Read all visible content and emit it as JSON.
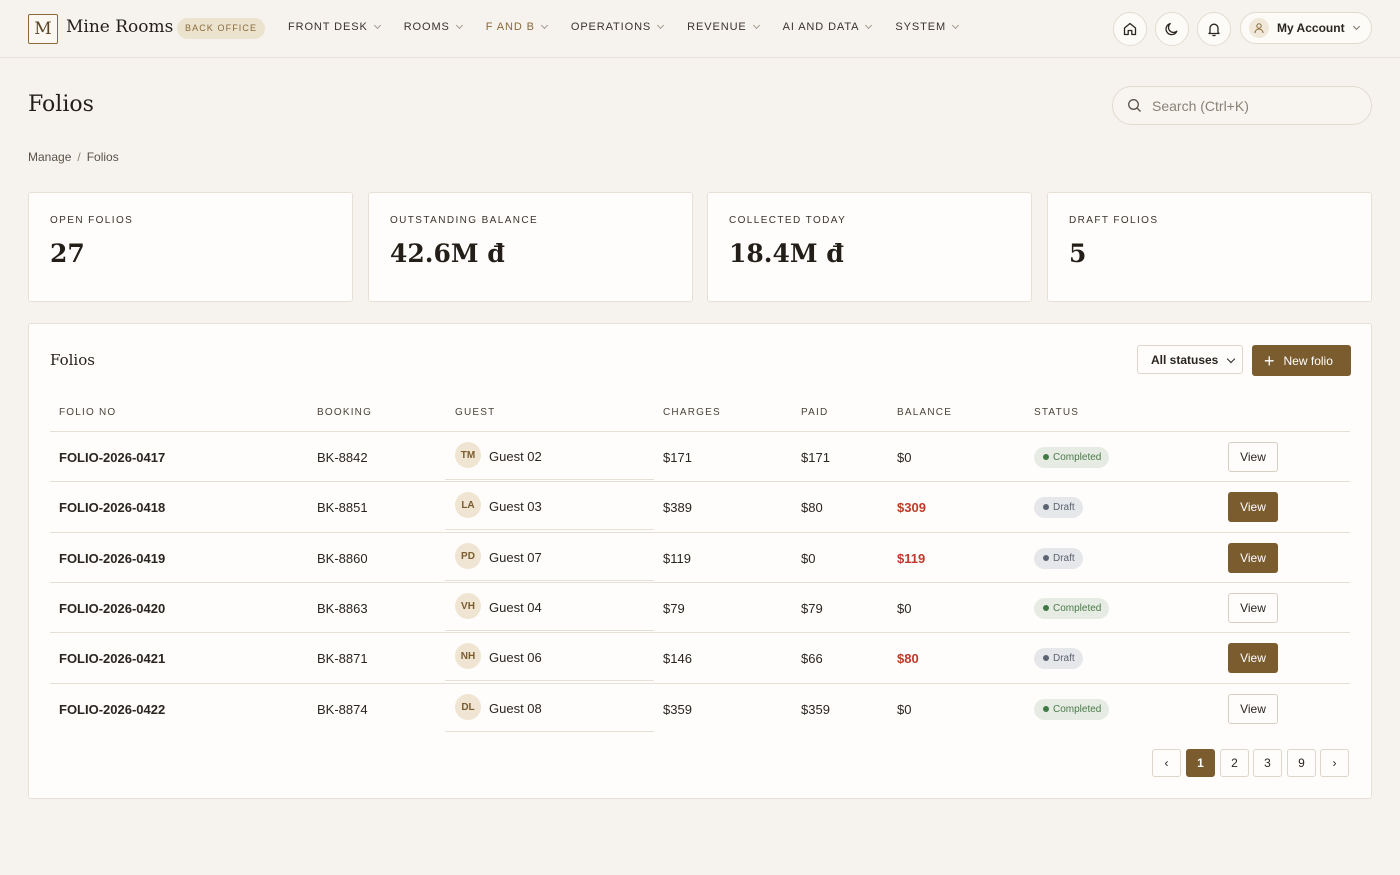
{
  "app": {
    "logo_letter": "M",
    "name": "Mine Rooms",
    "badge": "BACK OFFICE"
  },
  "nav": [
    {
      "label": "FRONT DESK"
    },
    {
      "label": "ROOMS"
    },
    {
      "label": "F AND B",
      "active": true
    },
    {
      "label": "OPERATIONS"
    },
    {
      "label": "REVENUE"
    },
    {
      "label": "AI AND DATA"
    },
    {
      "label": "SYSTEM"
    }
  ],
  "header_icons": [
    "home-icon",
    "moon-icon",
    "bell-icon"
  ],
  "account": {
    "label": "My Account"
  },
  "page": {
    "title": "Folios"
  },
  "search": {
    "placeholder": "Search (Ctrl+K)"
  },
  "breadcrumb": {
    "parent": "Manage",
    "separator": "/",
    "current": "Folios"
  },
  "stats": [
    {
      "label": "OPEN FOLIOS",
      "value": "27"
    },
    {
      "label": "OUTSTANDING BALANCE",
      "value": "42.6M đ"
    },
    {
      "label": "COLLECTED TODAY",
      "value": "18.4M đ"
    },
    {
      "label": "DRAFT FOLIOS",
      "value": "5"
    }
  ],
  "table": {
    "title": "Folios",
    "filter": {
      "selected": "All statuses"
    },
    "new_button": "New folio",
    "columns": [
      "FOLIO NO",
      "BOOKING",
      "GUEST",
      "CHARGES",
      "PAID",
      "BALANCE",
      "STATUS"
    ],
    "rows": [
      {
        "folio": "FOLIO-2026-0417",
        "booking": "BK-8842",
        "initials": "TM",
        "guest": "Guest 02",
        "charges": "$171",
        "paid": "$171",
        "balance": "$0",
        "outstanding": false,
        "status": "Completed",
        "action": "View"
      },
      {
        "folio": "FOLIO-2026-0418",
        "booking": "BK-8851",
        "initials": "LA",
        "guest": "Guest 03",
        "charges": "$389",
        "paid": "$80",
        "balance": "$309",
        "outstanding": true,
        "status": "Draft",
        "action": "View"
      },
      {
        "folio": "FOLIO-2026-0419",
        "booking": "BK-8860",
        "initials": "PD",
        "guest": "Guest 07",
        "charges": "$119",
        "paid": "$0",
        "balance": "$119",
        "outstanding": true,
        "status": "Draft",
        "action": "View"
      },
      {
        "folio": "FOLIO-2026-0420",
        "booking": "BK-8863",
        "initials": "VH",
        "guest": "Guest 04",
        "charges": "$79",
        "paid": "$79",
        "balance": "$0",
        "outstanding": false,
        "status": "Completed",
        "action": "View"
      },
      {
        "folio": "FOLIO-2026-0421",
        "booking": "BK-8871",
        "initials": "NH",
        "guest": "Guest 06",
        "charges": "$146",
        "paid": "$66",
        "balance": "$80",
        "outstanding": true,
        "status": "Draft",
        "action": "View"
      },
      {
        "folio": "FOLIO-2026-0422",
        "booking": "BK-8874",
        "initials": "DL",
        "guest": "Guest 08",
        "charges": "$359",
        "paid": "$359",
        "balance": "$0",
        "outstanding": false,
        "status": "Completed",
        "action": "View"
      }
    ]
  },
  "pagination": {
    "prev": "‹",
    "pages": [
      "1",
      "2",
      "3",
      "9"
    ],
    "current": "1",
    "next": "›"
  },
  "colors": {
    "accent": "#7a5c2f",
    "negative": "#c0392b",
    "completed": "#3f7a45",
    "draft": "#5b6472",
    "background": "#f6f3ee"
  }
}
